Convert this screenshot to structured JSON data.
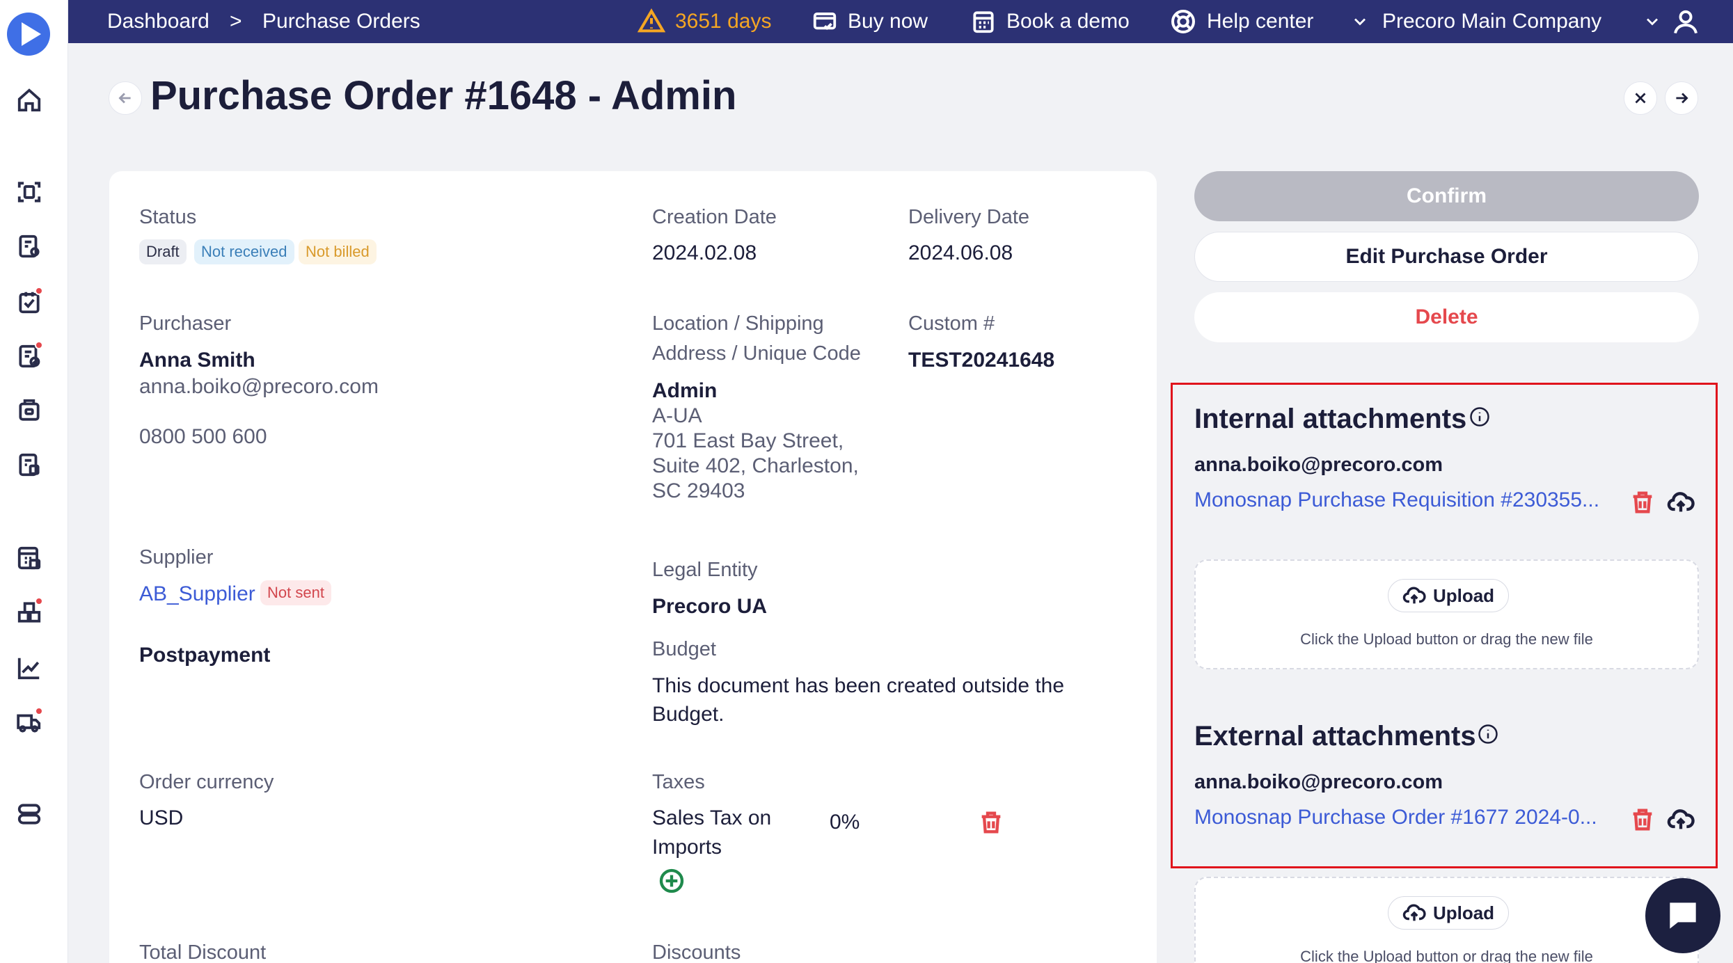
{
  "nav": {
    "breadcrumb_dashboard": "Dashboard",
    "breadcrumb_sep": ">",
    "breadcrumb_current": "Purchase Orders",
    "trial_days": "3651 days",
    "buy_now": "Buy now",
    "book_demo": "Book a demo",
    "help_center": "Help center",
    "company": "Precoro Main Company"
  },
  "page": {
    "title": "Purchase Order #1648 - Admin"
  },
  "details": {
    "status_label": "Status",
    "status_badges": [
      "Draft",
      "Not received",
      "Not billed"
    ],
    "creation_date_label": "Creation Date",
    "creation_date": "2024.02.08",
    "delivery_date_label": "Delivery Date",
    "delivery_date": "2024.06.08",
    "purchaser_label": "Purchaser",
    "purchaser_name": "Anna Smith",
    "purchaser_email": "anna.boiko@precoro.com",
    "purchaser_phone": "0800 500 600",
    "location_label_1": "Location / Shipping",
    "location_label_2": "Address / Unique Code",
    "location_name": "Admin",
    "location_code": "A-UA",
    "address_1": "701 East Bay Street,",
    "address_2": "Suite 402, Charleston,",
    "address_3": "SC 29403",
    "custom_label": "Custom #",
    "custom_value": "TEST20241648",
    "supplier_label": "Supplier",
    "supplier_name": "AB_Supplier",
    "supplier_badge": "Not sent",
    "payment_terms": "Postpayment",
    "legal_entity_label": "Legal Entity",
    "legal_entity": "Precoro UA",
    "budget_label": "Budget",
    "budget_text_1": "This document has been created outside the",
    "budget_text_2": "Budget.",
    "currency_label": "Order currency",
    "currency": "USD",
    "taxes_label": "Taxes",
    "tax_name_1": "Sales Tax on",
    "tax_name_2": "Imports",
    "tax_rate": "0%",
    "total_discount_label": "Total Discount",
    "discounts_label": "Discounts"
  },
  "actions": {
    "confirm": "Confirm",
    "edit": "Edit Purchase Order",
    "delete": "Delete"
  },
  "attachments": {
    "internal_title": "Internal attachments",
    "internal_email": "anna.boiko@precoro.com",
    "internal_file": "Monosnap Purchase Requisition #230355...",
    "upload_label": "Upload",
    "upload_hint": "Click the Upload button or drag the new file",
    "external_title": "External attachments",
    "external_email": "anna.boiko@precoro.com",
    "external_file": "Monosnap Purchase Order #1677 2024-0..."
  },
  "colors": {
    "topbar": "#2c3174",
    "accent_link": "#3c5bd6",
    "danger": "#e5484d",
    "highlight_border": "#e0141c"
  }
}
